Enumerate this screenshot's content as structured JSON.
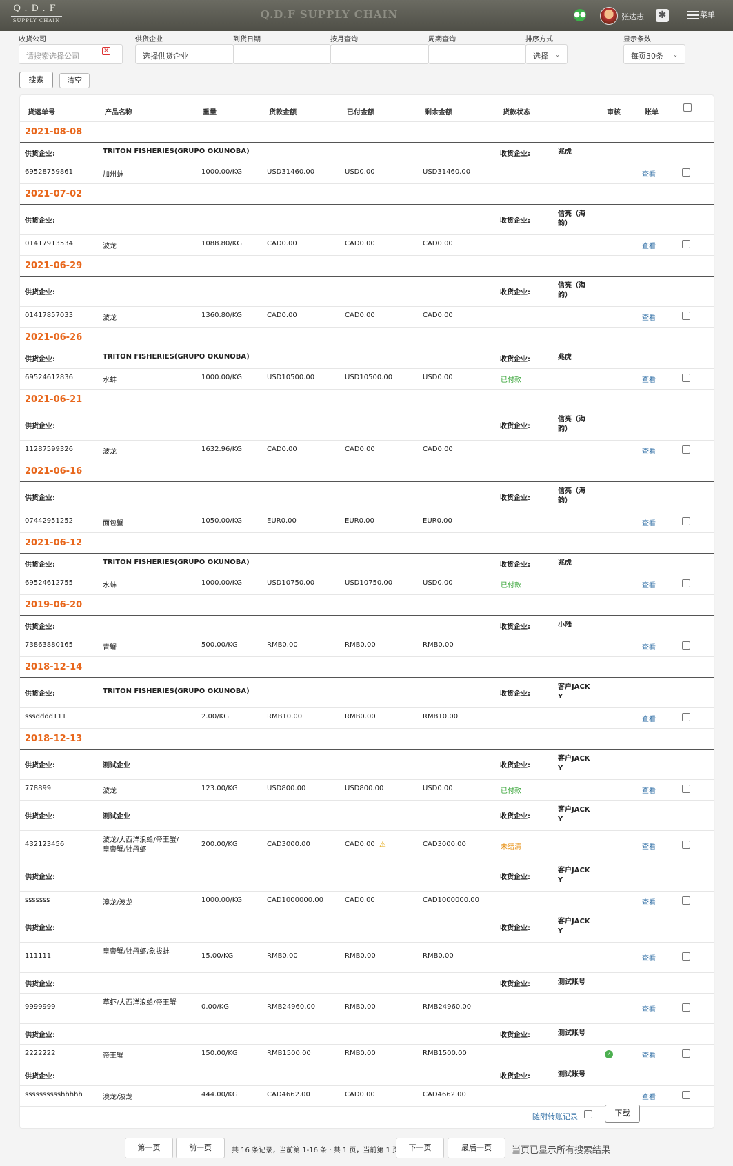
{
  "header": {
    "logo_line1": "Q.D.F",
    "logo_line2": "SUPPLY CHAIN",
    "brand": "Q.D.F SUPPLY CHAIN",
    "user_name": "张达志",
    "menu_label": "菜单",
    "wechat_icon": "wechat-icon",
    "settings_icon": "gear-icon"
  },
  "filters": {
    "receiver_label": "收货公司",
    "receiver_placeholder": "请搜索选择公司",
    "supplier_label": "供货企业",
    "supplier_value": "选择供货企业",
    "arrival_label": "到货日期",
    "month_label": "按月查询",
    "period_label": "周期查询",
    "sort_label": "排序方式",
    "sort_value": "选择",
    "pagesize_label": "显示条数",
    "pagesize_value": "每页30条",
    "search_btn": "搜索",
    "clear_btn": "清空"
  },
  "table": {
    "headers": [
      "货运单号",
      "产品名称",
      "重量",
      "货款金额",
      "已付金额",
      "剩余金额",
      "货款状态",
      "审核",
      "账单"
    ],
    "supplier_label": "供货企业:",
    "receiver_label": "收货企业:",
    "view_label": "查看",
    "groups": [
      {
        "date": "2021-08-08",
        "entries": [
          {
            "supplier": "TRITON FISHERIES(GRUPO OKUNOBA)",
            "receiver": "兆虎",
            "no": "69528759861",
            "product": "加州蚌",
            "weight": "1000.00/KG",
            "amount": "USD31460.00",
            "paid": "USD0.00",
            "remain": "USD31460.00",
            "status": "",
            "audit": false,
            "warn": false
          }
        ]
      },
      {
        "date": "2021-07-02",
        "entries": [
          {
            "supplier": "",
            "receiver": "信亮（海韵）",
            "no": "01417913534",
            "product": "波龙",
            "weight": "1088.80/KG",
            "amount": "CAD0.00",
            "paid": "CAD0.00",
            "remain": "CAD0.00",
            "status": "",
            "audit": false,
            "warn": false
          }
        ]
      },
      {
        "date": "2021-06-29",
        "entries": [
          {
            "supplier": "",
            "receiver": "信亮（海韵）",
            "no": "01417857033",
            "product": "波龙",
            "weight": "1360.80/KG",
            "amount": "CAD0.00",
            "paid": "CAD0.00",
            "remain": "CAD0.00",
            "status": "",
            "audit": false,
            "warn": false
          }
        ]
      },
      {
        "date": "2021-06-26",
        "entries": [
          {
            "supplier": "TRITON FISHERIES(GRUPO OKUNOBA)",
            "receiver": "兆虎",
            "no": "69524612836",
            "product": "水蚌",
            "weight": "1000.00/KG",
            "amount": "USD10500.00",
            "paid": "USD10500.00",
            "remain": "USD0.00",
            "status": "已付款",
            "audit": false,
            "warn": false
          }
        ]
      },
      {
        "date": "2021-06-21",
        "entries": [
          {
            "supplier": "",
            "receiver": "信亮（海韵）",
            "no": "11287599326",
            "product": "波龙",
            "weight": "1632.96/KG",
            "amount": "CAD0.00",
            "paid": "CAD0.00",
            "remain": "CAD0.00",
            "status": "",
            "audit": false,
            "warn": false
          }
        ]
      },
      {
        "date": "2021-06-16",
        "entries": [
          {
            "supplier": "",
            "receiver": "信亮（海韵）",
            "no": "07442951252",
            "product": "面包蟹",
            "weight": "1050.00/KG",
            "amount": "EUR0.00",
            "paid": "EUR0.00",
            "remain": "EUR0.00",
            "status": "",
            "audit": false,
            "warn": false
          }
        ]
      },
      {
        "date": "2021-06-12",
        "entries": [
          {
            "supplier": "TRITON FISHERIES(GRUPO OKUNOBA)",
            "receiver": "兆虎",
            "no": "69524612755",
            "product": "水蚌",
            "weight": "1000.00/KG",
            "amount": "USD10750.00",
            "paid": "USD10750.00",
            "remain": "USD0.00",
            "status": "已付款",
            "audit": false,
            "warn": false
          }
        ]
      },
      {
        "date": "2019-06-20",
        "entries": [
          {
            "supplier": "",
            "receiver": "小陆",
            "no": "73863880165",
            "product": "青蟹",
            "weight": "500.00/KG",
            "amount": "RMB0.00",
            "paid": "RMB0.00",
            "remain": "RMB0.00",
            "status": "",
            "audit": false,
            "warn": false
          }
        ]
      },
      {
        "date": "2018-12-14",
        "entries": [
          {
            "supplier": "TRITON FISHERIES(GRUPO OKUNOBA)",
            "receiver": "客户JACKY",
            "no": "sssdddd111",
            "product": "",
            "weight": "2.00/KG",
            "amount": "RMB10.00",
            "paid": "RMB0.00",
            "remain": "RMB10.00",
            "status": "",
            "audit": false,
            "warn": false
          }
        ]
      },
      {
        "date": "2018-12-13",
        "entries": [
          {
            "supplier": "测试企业",
            "receiver": "客户JACKY",
            "no": "778899",
            "product": "波龙",
            "weight": "123.00/KG",
            "amount": "USD800.00",
            "paid": "USD800.00",
            "remain": "USD0.00",
            "status": "已付款",
            "audit": false,
            "warn": false
          },
          {
            "supplier": "测试企业",
            "receiver": "客户JACKY",
            "no": "432123456",
            "product": "波龙/大西洋浪蛤/帝王蟹/皇帝蟹/牡丹虾",
            "weight": "200.00/KG",
            "amount": "CAD3000.00",
            "paid": "CAD0.00",
            "remain": "CAD3000.00",
            "status": "未结清",
            "audit": false,
            "warn": true
          },
          {
            "supplier": "",
            "receiver": "客户JACKY",
            "no": "sssssss",
            "product": "澳龙/波龙",
            "weight": "1000.00/KG",
            "amount": "CAD1000000.00",
            "paid": "CAD0.00",
            "remain": "CAD1000000.00",
            "status": "",
            "audit": false,
            "warn": false
          },
          {
            "supplier": "",
            "receiver": "客户JACKY",
            "no": "111111",
            "product": "皇帝蟹/牡丹虾/象拔蚌",
            "weight": "15.00/KG",
            "amount": "RMB0.00",
            "paid": "RMB0.00",
            "remain": "RMB0.00",
            "status": "",
            "audit": false,
            "warn": false
          },
          {
            "supplier": "",
            "receiver": "测试账号",
            "no": "9999999",
            "product": "草虾/大西洋浪蛤/帝王蟹",
            "weight": "0.00/KG",
            "amount": "RMB24960.00",
            "paid": "RMB0.00",
            "remain": "RMB24960.00",
            "status": "",
            "audit": false,
            "warn": false
          },
          {
            "supplier": "",
            "receiver": "测试账号",
            "no": "2222222",
            "product": "帝王蟹",
            "weight": "150.00/KG",
            "amount": "RMB1500.00",
            "paid": "RMB0.00",
            "remain": "RMB1500.00",
            "status": "",
            "audit": true,
            "warn": false
          },
          {
            "supplier": "",
            "receiver": "测试账号",
            "no": "sssssssssshhhhh",
            "product": "澳龙/波龙",
            "weight": "444.00/KG",
            "amount": "CAD4662.00",
            "paid": "CAD0.00",
            "remain": "CAD4662.00",
            "status": "",
            "audit": false,
            "warn": false
          }
        ]
      }
    ]
  },
  "footer": {
    "transfer_label": "随附转账记录",
    "download_btn": "下载"
  },
  "pagination": {
    "first": "第一页",
    "prev": "前一页",
    "info": "共 16 条记录，当前第 1-16 条 · 共 1 页，当前第 1 页",
    "next": "下一页",
    "last": "最后一页",
    "end_note": "当页已显示所有搜索结果"
  }
}
